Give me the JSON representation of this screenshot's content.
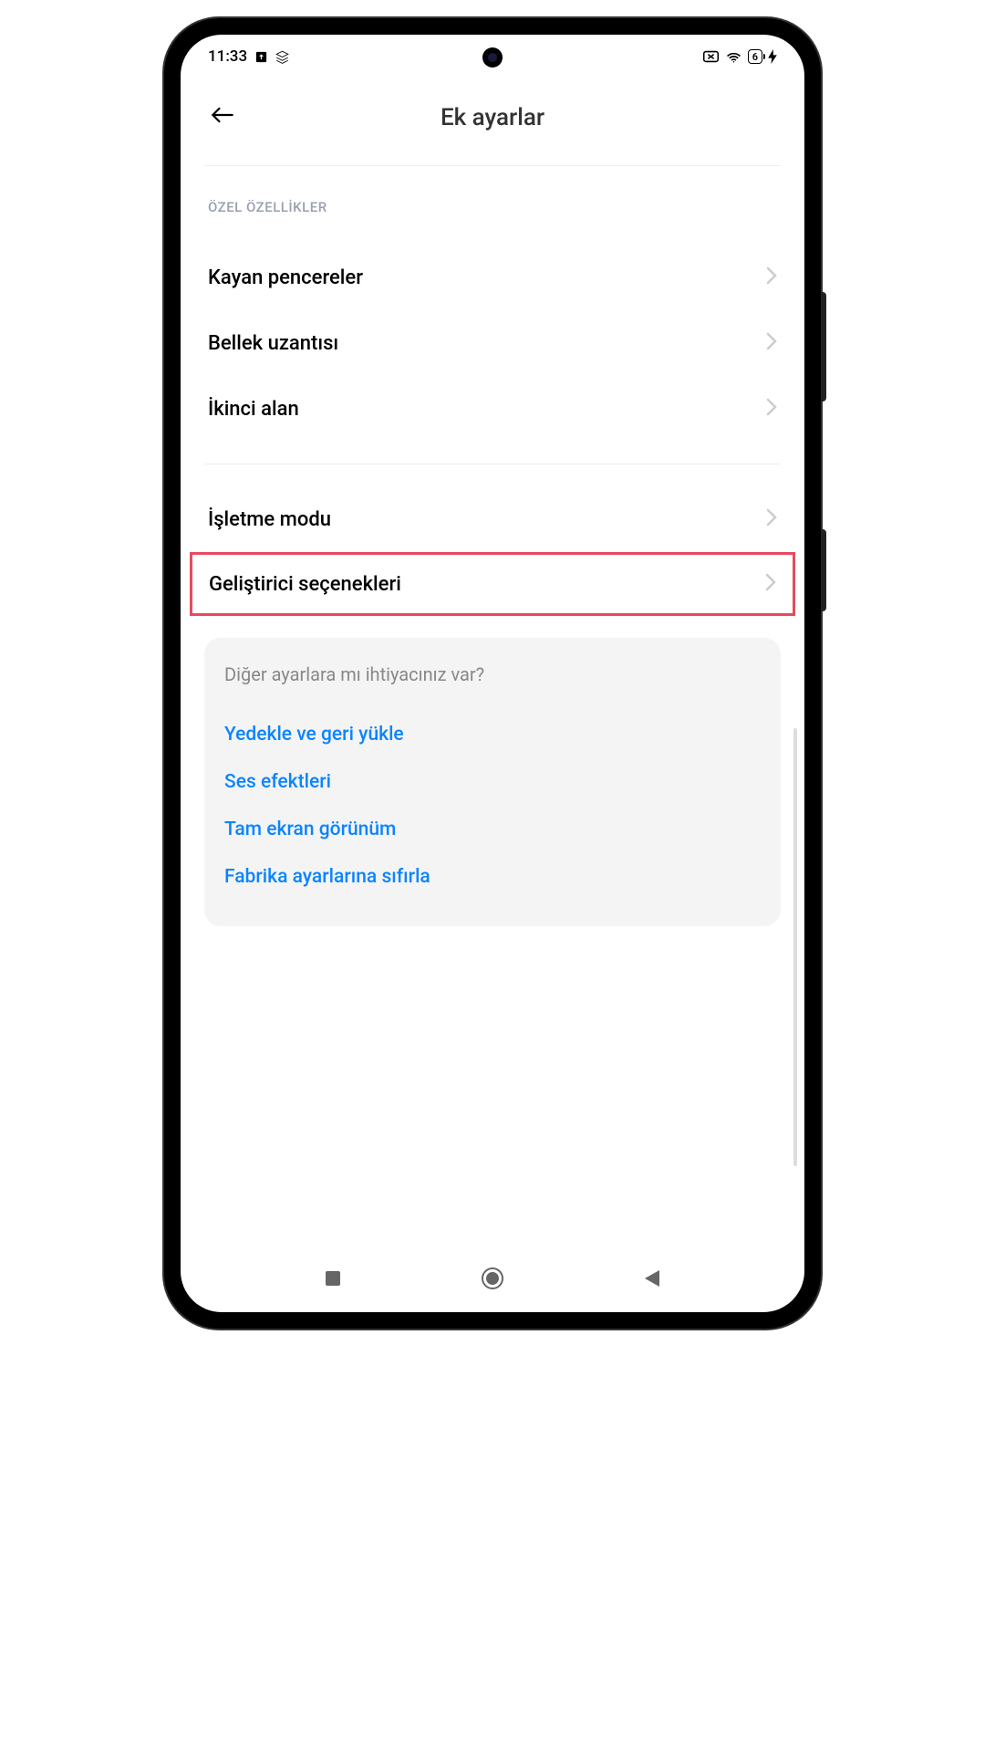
{
  "status_bar": {
    "time": "11:33",
    "battery_level": "6"
  },
  "header": {
    "title": "Ek ayarlar"
  },
  "content": {
    "section_header": "ÖZEL ÖZELLİKLER",
    "items_group1": [
      {
        "label": "Kayan pencereler"
      },
      {
        "label": "Bellek uzantısı"
      },
      {
        "label": "İkinci alan"
      }
    ],
    "items_group2": [
      {
        "label": "İşletme modu"
      },
      {
        "label": "Geliştirici seçenekleri",
        "highlighted": true
      }
    ]
  },
  "suggestions": {
    "title": "Diğer ayarlara mı ihtiyacınız var?",
    "links": [
      "Yedekle ve geri yükle",
      "Ses efektleri",
      "Tam ekran görünüm",
      "Fabrika ayarlarına sıfırla"
    ]
  }
}
